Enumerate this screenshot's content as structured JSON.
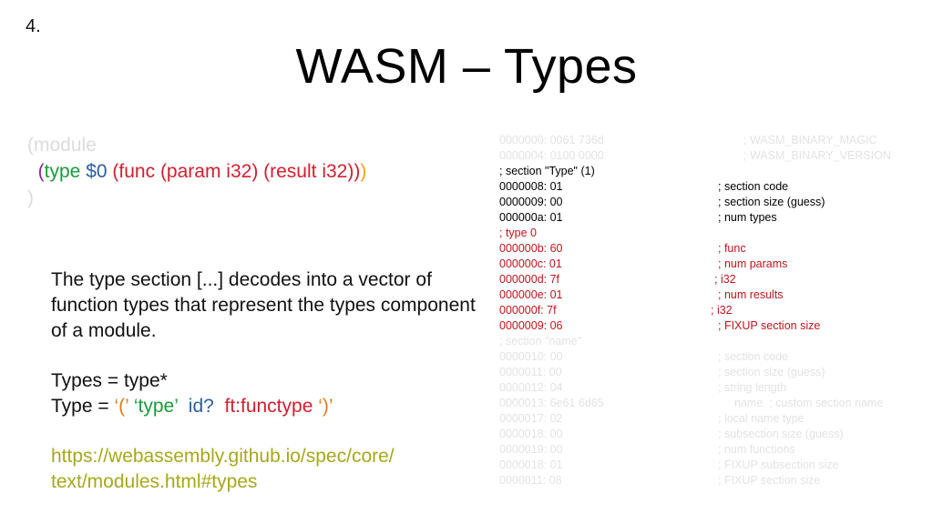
{
  "slide_number": "4.",
  "title": "WASM – Types",
  "wat_code": {
    "line1": "(module",
    "line2": {
      "open": "(",
      "type_kw": "type",
      "id": "$0",
      "func": "(func (param i32) (result i32)",
      "close_inner": ")",
      "close_outer": ")"
    },
    "line3": ")"
  },
  "description": "The type section [...] decodes into a vector of function types that represent the types component of a module.",
  "grammar": {
    "types_line": "Types = type*",
    "type_prefix": "Type = ",
    "lparen": "‘(’",
    "type_kw": "‘type’",
    "id": "id?",
    "ft": "ft:functype",
    "rparen": "‘)’"
  },
  "link": {
    "line1": "https://webassembly.github.io/spec/core/",
    "line2": "text/modules.html#types"
  },
  "hexdump": [
    {
      "addr": "0000000: 0061 736d",
      "comment": "; WASM_BINARY_MAGIC",
      "style": "faint",
      "cpos": "c1"
    },
    {
      "addr": "0000004: 0100 0000",
      "comment": "; WASM_BINARY_VERSION",
      "style": "faint",
      "cpos": "c1"
    },
    {
      "addr": "; section \"Type\" (1)",
      "comment": "",
      "style": "black",
      "cpos": "c2"
    },
    {
      "addr": "0000008: 01",
      "comment": "; section code",
      "style": "black",
      "cpos": "c2"
    },
    {
      "addr": "0000009: 00",
      "comment": "; section size (guess)",
      "style": "black",
      "cpos": "c2"
    },
    {
      "addr": "000000a: 01",
      "comment": "; num types",
      "style": "black",
      "cpos": "c2"
    },
    {
      "addr": "; type 0",
      "comment": "",
      "style": "red",
      "cpos": "c2"
    },
    {
      "addr": "000000b: 60",
      "comment": "; func",
      "style": "red",
      "cpos": "c2"
    },
    {
      "addr": "000000c: 01",
      "comment": "; num params",
      "style": "red",
      "cpos": "c2"
    },
    {
      "addr": "000000d: 7f",
      "comment": "; i32",
      "style": "red",
      "cpos": "c3"
    },
    {
      "addr": "000000e: 01",
      "comment": "; num results",
      "style": "red",
      "cpos": "c2"
    },
    {
      "addr": "000000f: 7f",
      "comment": "; i32",
      "style": "red",
      "cpos": "c4"
    },
    {
      "addr": "0000009: 06",
      "comment": "; FIXUP section size",
      "style": "red",
      "cpos": "c2"
    },
    {
      "addr": "; section \"name\"",
      "comment": "",
      "style": "faint",
      "cpos": "c2"
    },
    {
      "addr": "0000010: 00",
      "comment": "; section code",
      "style": "faint",
      "cpos": "c2"
    },
    {
      "addr": "0000011: 00",
      "comment": "; section size (guess)",
      "style": "faint",
      "cpos": "c2"
    },
    {
      "addr": "0000012: 04",
      "comment": "; string length",
      "style": "faint",
      "cpos": "c2"
    },
    {
      "addr": "0000013: 6e61 6d65",
      "comment": "name  ; custom section name",
      "style": "faint",
      "cpos": "c5"
    },
    {
      "addr": "0000017: 02",
      "comment": "; local name type",
      "style": "faint",
      "cpos": "c2"
    },
    {
      "addr": "0000018: 00",
      "comment": "; subsection size (guess)",
      "style": "faint",
      "cpos": "c2"
    },
    {
      "addr": "0000019: 00",
      "comment": "; num functions",
      "style": "faint",
      "cpos": "c2"
    },
    {
      "addr": "0000018: 01",
      "comment": "; FIXUP subsection size",
      "style": "faint",
      "cpos": "c2"
    },
    {
      "addr": "0000011: 08",
      "comment": "; FIXUP section size",
      "style": "faint",
      "cpos": "c2"
    }
  ]
}
